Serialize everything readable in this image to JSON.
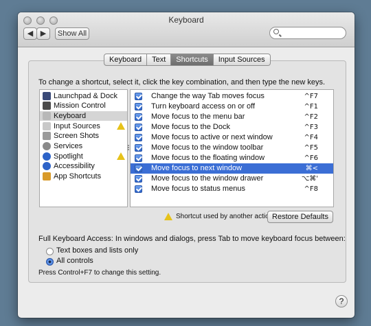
{
  "window": {
    "title": "Keyboard"
  },
  "toolbar": {
    "back_label": "◀",
    "forward_label": "▶",
    "show_all_label": "Show All",
    "search_placeholder": ""
  },
  "tabs": [
    {
      "label": "Keyboard",
      "active": false
    },
    {
      "label": "Text",
      "active": false
    },
    {
      "label": "Shortcuts",
      "active": true
    },
    {
      "label": "Input Sources",
      "active": false
    }
  ],
  "instruction": "To change a shortcut, select it, click the key combination, and then type the new keys.",
  "categories": [
    {
      "label": "Launchpad & Dock",
      "icon": "launchpad-dock-icon",
      "color": "#3a4a78",
      "warning": false,
      "selected": false
    },
    {
      "label": "Mission Control",
      "icon": "mission-control-icon",
      "color": "#4b4b4b",
      "warning": false,
      "selected": false
    },
    {
      "label": "Keyboard",
      "icon": "keyboard-icon",
      "color": "#b8b8b8",
      "warning": false,
      "selected": true
    },
    {
      "label": "Input Sources",
      "icon": "input-sources-icon",
      "color": "#c8c8c8",
      "warning": true,
      "selected": false
    },
    {
      "label": "Screen Shots",
      "icon": "screenshot-icon",
      "color": "#9a9a9a",
      "warning": false,
      "selected": false
    },
    {
      "label": "Services",
      "icon": "gear-icon",
      "color": "#8a8a8a",
      "warning": false,
      "selected": false
    },
    {
      "label": "Spotlight",
      "icon": "spotlight-icon",
      "color": "#2d63c8",
      "warning": true,
      "selected": false
    },
    {
      "label": "Accessibility",
      "icon": "accessibility-icon",
      "color": "#2d63c8",
      "warning": false,
      "selected": false
    },
    {
      "label": "App Shortcuts",
      "icon": "app-shortcuts-icon",
      "color": "#d89a2a",
      "warning": false,
      "selected": false
    }
  ],
  "shortcuts": [
    {
      "label": "Change the way Tab moves focus",
      "key": "^F7",
      "checked": true,
      "selected": false
    },
    {
      "label": "Turn keyboard access on or off",
      "key": "^F1",
      "checked": true,
      "selected": false
    },
    {
      "label": "Move focus to the menu bar",
      "key": "^F2",
      "checked": true,
      "selected": false
    },
    {
      "label": "Move focus to the Dock",
      "key": "^F3",
      "checked": true,
      "selected": false
    },
    {
      "label": "Move focus to active or next window",
      "key": "^F4",
      "checked": true,
      "selected": false
    },
    {
      "label": "Move focus to the window toolbar",
      "key": "^F5",
      "checked": true,
      "selected": false
    },
    {
      "label": "Move focus to the floating window",
      "key": "^F6",
      "checked": true,
      "selected": false
    },
    {
      "label": "Move focus to next window",
      "key": "⌘<",
      "checked": true,
      "selected": true
    },
    {
      "label": "Move focus to the window drawer",
      "key": "⌥⌘'",
      "checked": true,
      "selected": false
    },
    {
      "label": "Move focus to status menus",
      "key": "^F8",
      "checked": true,
      "selected": false
    }
  ],
  "legend": {
    "text": "Shortcut used by another action"
  },
  "restore_defaults_label": "Restore Defaults",
  "full_keyboard_access": {
    "text": "Full Keyboard Access: In windows and dialogs, press Tab to move keyboard focus between:",
    "options": [
      {
        "label": "Text boxes and lists only",
        "selected": false
      },
      {
        "label": "All controls",
        "selected": true
      }
    ],
    "hint": "Press Control+F7 to change this setting."
  },
  "help_label": "?"
}
